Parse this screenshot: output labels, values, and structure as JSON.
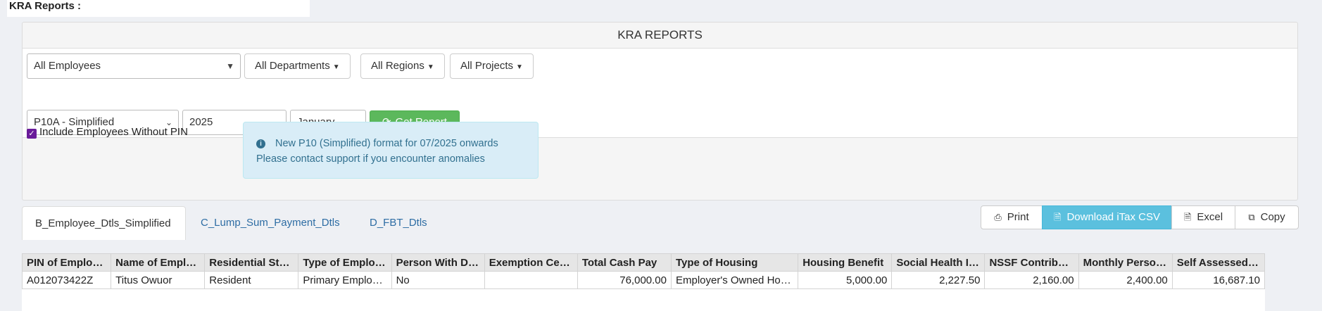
{
  "page": {
    "title": "KRA Reports :"
  },
  "panel": {
    "heading": "KRA REPORTS"
  },
  "filters": {
    "employees": "All Employees",
    "departments": "All Departments",
    "regions": "All Regions",
    "projects": "All Projects",
    "report_type": "P10A - Simplified",
    "year": "2025",
    "month": "January",
    "get_report": "Get Report"
  },
  "options": {
    "include_without_pin": "Include Employees Without PIN"
  },
  "alert": {
    "line1": "New P10 (Simplified) format for 07/2025 onwards",
    "line2": "Please contact support if you encounter anomalies"
  },
  "tabs": [
    {
      "label": "B_Employee_Dtls_Simplified",
      "active": true
    },
    {
      "label": "C_Lump_Sum_Payment_Dtls",
      "active": false
    },
    {
      "label": "D_FBT_Dtls",
      "active": false
    }
  ],
  "toolbar": {
    "print": "Print",
    "download": "Download iTax CSV",
    "excel": "Excel",
    "copy": "Copy"
  },
  "table": {
    "headers": [
      "PIN of Employee",
      "Name of Employee",
      "Residential Status",
      "Type of Employee",
      "Person With Disability",
      "Exemption Certificate",
      "Total Cash Pay",
      "Type of Housing",
      "Housing Benefit",
      "Social Health Insurance",
      "NSSF Contribution",
      "Monthly Personal Relief",
      "Self Assessed PAYE"
    ],
    "rows": [
      [
        "A012073422Z",
        "Titus Owuor",
        "Resident",
        "Primary Employee",
        "No",
        "",
        "76,000.00",
        "Employer's Owned House",
        "5,000.00",
        "2,227.50",
        "2,160.00",
        "2,400.00",
        "16,687.10"
      ]
    ]
  },
  "colors": {
    "accent_green": "#5cb85c",
    "accent_blue": "#5bc0de",
    "info_bg": "#d9edf7"
  }
}
